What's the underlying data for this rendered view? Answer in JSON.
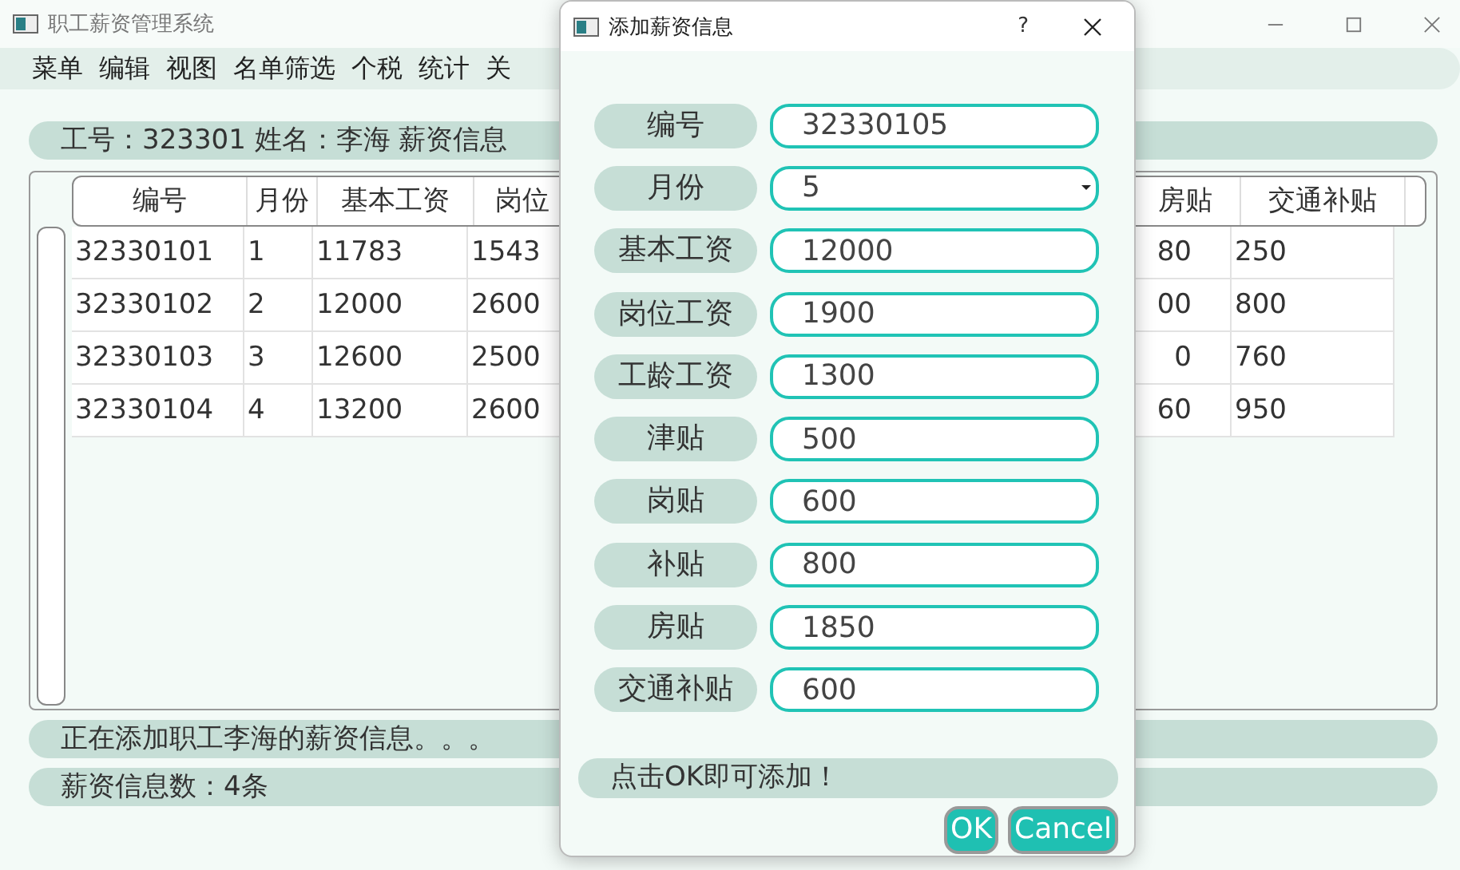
{
  "window": {
    "title": "职工薪资管理系统"
  },
  "menu": [
    "菜单",
    "编辑",
    "视图",
    "名单筛选",
    "个税",
    "统计",
    "关"
  ],
  "info": "工号：323301  姓名：李海  薪资信息",
  "table": {
    "columns": [
      "编号",
      "月份",
      "基本工资",
      "岗位",
      "房贴",
      "交通补贴"
    ],
    "rows": [
      {
        "cells": [
          "32330101",
          "1",
          "11783",
          "1543",
          "80",
          "250"
        ]
      },
      {
        "cells": [
          "32330102",
          "2",
          "12000",
          "2600",
          "00",
          "800"
        ]
      },
      {
        "cells": [
          "32330103",
          "3",
          "12600",
          "2500",
          "0",
          "760"
        ]
      },
      {
        "cells": [
          "32330104",
          "4",
          "13200",
          "2600",
          "60",
          "950"
        ]
      }
    ]
  },
  "status_bar": [
    "正在添加职工李海的薪资信息。。。",
    "薪资信息数：4条"
  ],
  "dialog": {
    "title": "添加薪资信息",
    "help": "?",
    "fields": [
      {
        "label": "编号",
        "value": "32330105",
        "kind": "text"
      },
      {
        "label": "月份",
        "value": "5",
        "kind": "combo"
      },
      {
        "label": "基本工资",
        "value": "12000",
        "kind": "text"
      },
      {
        "label": "岗位工资",
        "value": "1900",
        "kind": "text"
      },
      {
        "label": "工龄工资",
        "value": "1300",
        "kind": "text"
      },
      {
        "label": "津贴",
        "value": "500",
        "kind": "text"
      },
      {
        "label": "岗贴",
        "value": "600",
        "kind": "text"
      },
      {
        "label": "补贴",
        "value": "800",
        "kind": "text"
      },
      {
        "label": "房贴",
        "value": "1850",
        "kind": "text"
      },
      {
        "label": "交通补贴",
        "value": "600",
        "kind": "text"
      }
    ],
    "hint": "点击OK即可添加！",
    "buttons": [
      "OK",
      "Cancel"
    ]
  }
}
